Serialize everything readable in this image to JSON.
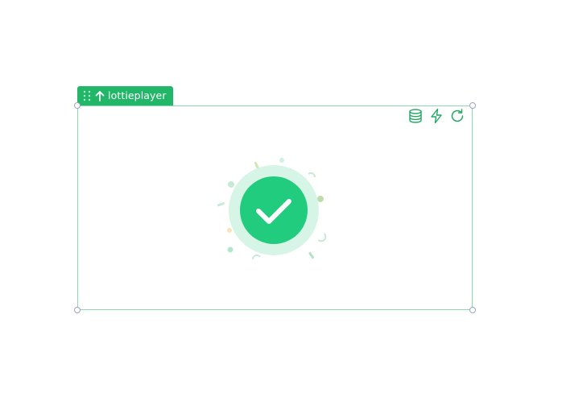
{
  "element_tag": {
    "label": "lottieplayer",
    "icons": [
      "drag-handle-icon",
      "arrow-up-icon"
    ]
  },
  "toolbar": {
    "buttons": [
      {
        "icon": "database-icon"
      },
      {
        "icon": "lightning-icon"
      },
      {
        "icon": "refresh-icon"
      }
    ]
  },
  "animation": {
    "state": "success",
    "icon": "checkmark-icon",
    "colors": {
      "accent": "#22cc7e",
      "halo": "#d6f5e6",
      "frame": "#8fd9b1",
      "tag": "#22b768"
    }
  }
}
